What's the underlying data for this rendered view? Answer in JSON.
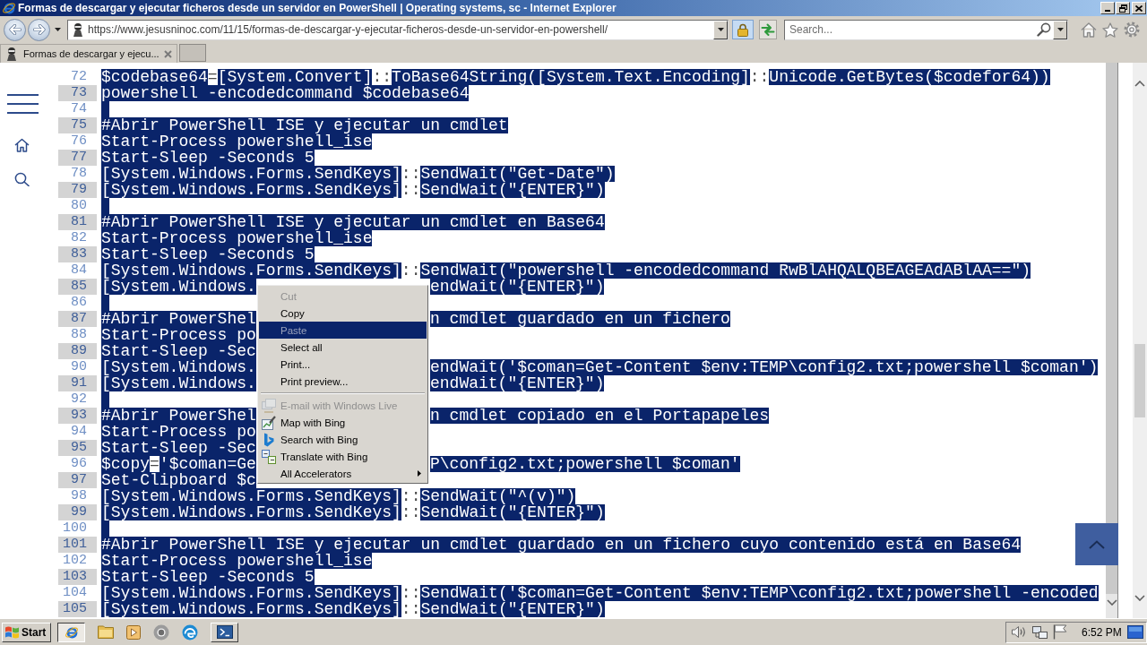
{
  "window": {
    "title": "Formas de descargar y ejecutar ficheros desde un servidor en PowerShell | Operating systems, sc - Internet Explorer"
  },
  "address_bar": {
    "url": "https://www.jesusninoc.com/11/15/formas-de-descargar-y-ejecutar-ficheros-desde-un-servidor-en-powershell/"
  },
  "search": {
    "placeholder": "Search..."
  },
  "tabs": [
    {
      "label": "Formas de descargar y ejecu...",
      "selected": true
    }
  ],
  "code_lines": [
    {
      "number": "72",
      "kind": "code",
      "segments": [
        {
          "text": "$codebase64",
          "selected": true
        },
        {
          "text": "=",
          "selected": false
        },
        {
          "text": "[System.Convert]",
          "selected": true
        },
        {
          "text": "::",
          "selected": false
        },
        {
          "text": "ToBase64String([System.Text.Encoding]",
          "selected": true
        },
        {
          "text": "::",
          "selected": false
        },
        {
          "text": "Unicode.GetBytes($codefor64))",
          "selected": true
        }
      ]
    },
    {
      "number": "73",
      "kind": "code",
      "segments": [
        {
          "text": "powershell -encodedcommand $codebase64",
          "selected": true
        }
      ]
    },
    {
      "number": "74",
      "kind": "blank",
      "selected": true
    },
    {
      "number": "75",
      "kind": "code",
      "segments": [
        {
          "text": "#Abrir PowerShell ISE y ejecutar un cmdlet",
          "selected": true
        }
      ]
    },
    {
      "number": "76",
      "kind": "code",
      "segments": [
        {
          "text": "Start-Process powershell_ise",
          "selected": true
        }
      ]
    },
    {
      "number": "77",
      "kind": "code",
      "segments": [
        {
          "text": "Start-Sleep -Seconds 5",
          "selected": true
        }
      ]
    },
    {
      "number": "78",
      "kind": "code",
      "segments": [
        {
          "text": "[System.Windows.Forms.SendKeys]",
          "selected": true
        },
        {
          "text": "::",
          "selected": false
        },
        {
          "text": "SendWait(\"Get-Date\")",
          "selected": true
        }
      ]
    },
    {
      "number": "79",
      "kind": "code",
      "segments": [
        {
          "text": "[System.Windows.Forms.SendKeys]",
          "selected": true
        },
        {
          "text": "::",
          "selected": false
        },
        {
          "text": "SendWait(\"{ENTER}\")",
          "selected": true
        }
      ]
    },
    {
      "number": "80",
      "kind": "blank",
      "selected": true
    },
    {
      "number": "81",
      "kind": "code",
      "segments": [
        {
          "text": "#Abrir PowerShell ISE y ejecutar un cmdlet en Base64",
          "selected": true
        }
      ]
    },
    {
      "number": "82",
      "kind": "code",
      "segments": [
        {
          "text": "Start-Process powershell_ise",
          "selected": true
        }
      ]
    },
    {
      "number": "83",
      "kind": "code",
      "segments": [
        {
          "text": "Start-Sleep -Seconds 5",
          "selected": true
        }
      ]
    },
    {
      "number": "84",
      "kind": "code",
      "segments": [
        {
          "text": "[System.Windows.Forms.SendKeys]",
          "selected": true
        },
        {
          "text": "::",
          "selected": false
        },
        {
          "text": "SendWait(\"powershell -encodedcommand RwBlAHQALQBEAGEAdABlAA==\")",
          "selected": true
        }
      ]
    },
    {
      "number": "85",
      "kind": "covered",
      "segments": [
        {
          "text": "[System.Windows.",
          "selected": true
        }
      ],
      "after_menu": [
        {
          "text": "endWait(\"{ENTER}\")",
          "selected": true
        }
      ]
    },
    {
      "number": "86",
      "kind": "blank",
      "selected": true
    },
    {
      "number": "87",
      "kind": "covered",
      "segments": [
        {
          "text": "#Abrir PowerShel",
          "selected": true
        }
      ],
      "after_menu": [
        {
          "text": "n cmdlet guardado en un fichero",
          "selected": true
        }
      ]
    },
    {
      "number": "88",
      "kind": "covered",
      "segments": [
        {
          "text": "Start-Process po",
          "selected": true
        }
      ]
    },
    {
      "number": "89",
      "kind": "covered",
      "segments": [
        {
          "text": "Start-Sleep -Sec",
          "selected": true
        }
      ]
    },
    {
      "number": "90",
      "kind": "covered",
      "segments": [
        {
          "text": "[System.Windows.",
          "selected": true
        }
      ],
      "after_menu": [
        {
          "text": "endWait('$coman=Get-Content $env:TEMP\\config2.txt;powershell $coman')",
          "selected": true
        }
      ]
    },
    {
      "number": "91",
      "kind": "covered",
      "segments": [
        {
          "text": "[System.Windows.",
          "selected": true
        }
      ],
      "after_menu": [
        {
          "text": "endWait(\"{ENTER}\")",
          "selected": true
        }
      ]
    },
    {
      "number": "92",
      "kind": "blank",
      "selected": true
    },
    {
      "number": "93",
      "kind": "covered",
      "segments": [
        {
          "text": "#Abrir PowerShel",
          "selected": true
        }
      ],
      "after_menu": [
        {
          "text": "n cmdlet copiado en el Portapapeles",
          "selected": true
        }
      ]
    },
    {
      "number": "94",
      "kind": "covered",
      "segments": [
        {
          "text": "Start-Process po",
          "selected": true
        }
      ]
    },
    {
      "number": "95",
      "kind": "covered",
      "segments": [
        {
          "text": "Start-Sleep -Sec",
          "selected": true
        }
      ]
    },
    {
      "number": "96",
      "kind": "covered",
      "segments": [
        {
          "text": "$copy",
          "selected": true
        },
        {
          "text": "=",
          "selected": false
        },
        {
          "text": "'$coman=Ge",
          "selected": true
        }
      ],
      "after_menu": [
        {
          "text": "P\\config2.txt;powershell $coman'",
          "selected": true
        }
      ]
    },
    {
      "number": "97",
      "kind": "covered",
      "segments": [
        {
          "text": "Set-Clipboard $c",
          "selected": true
        }
      ]
    },
    {
      "number": "98",
      "kind": "code",
      "segments": [
        {
          "text": "[System.Windows.Forms.SendKeys]",
          "selected": true
        },
        {
          "text": "::",
          "selected": false
        },
        {
          "text": "SendWait(\"^(v)\")",
          "selected": true
        }
      ]
    },
    {
      "number": "99",
      "kind": "code",
      "segments": [
        {
          "text": "[System.Windows.Forms.SendKeys]",
          "selected": true
        },
        {
          "text": "::",
          "selected": false
        },
        {
          "text": "SendWait(\"{ENTER}\")",
          "selected": true
        }
      ]
    },
    {
      "number": "100",
      "kind": "blank",
      "selected": true
    },
    {
      "number": "101",
      "kind": "code",
      "segments": [
        {
          "text": "#Abrir PowerShell ISE y ejecutar un cmdlet guardado en un fichero cuyo contenido está en Base64",
          "selected": true
        }
      ]
    },
    {
      "number": "102",
      "kind": "code",
      "segments": [
        {
          "text": "Start-Process powershell_ise",
          "selected": true
        }
      ]
    },
    {
      "number": "103",
      "kind": "code",
      "segments": [
        {
          "text": "Start-Sleep -Seconds 5",
          "selected": true
        }
      ]
    },
    {
      "number": "104",
      "kind": "code",
      "segments": [
        {
          "text": "[System.Windows.Forms.SendKeys]",
          "selected": true
        },
        {
          "text": "::",
          "selected": false
        },
        {
          "text": "SendWait('$coman=Get-Content $env:TEMP\\config2.txt;powershell -encoded",
          "selected": true
        }
      ]
    },
    {
      "number": "105",
      "kind": "code",
      "segments": [
        {
          "text": "[System.Windows.Forms.SendKeys]",
          "selected": true
        },
        {
          "text": "::",
          "selected": false
        },
        {
          "text": "SendWait(\"{ENTER}\")",
          "selected": true
        }
      ]
    }
  ],
  "context_menu": {
    "groups": [
      {
        "items": [
          {
            "label": "Cut",
            "kind": "plain",
            "disabled": true,
            "selected": false
          },
          {
            "label": "Copy",
            "kind": "plain",
            "disabled": false,
            "selected": false
          },
          {
            "label": "Paste",
            "kind": "plain",
            "disabled": true,
            "selected": true
          },
          {
            "label": "Select all",
            "kind": "plain",
            "disabled": false,
            "selected": false
          },
          {
            "label": "Print...",
            "kind": "plain",
            "disabled": false,
            "selected": false
          },
          {
            "label": "Print preview...",
            "kind": "plain",
            "disabled": false,
            "selected": false
          }
        ]
      },
      {
        "items": [
          {
            "label": "E-mail with Windows Live",
            "kind": "accelerator",
            "disabled": true,
            "selected": false
          },
          {
            "label": "Map with Bing",
            "kind": "accelerator",
            "disabled": false,
            "selected": false
          },
          {
            "label": "Search with Bing",
            "kind": "accelerator",
            "disabled": false,
            "selected": false
          },
          {
            "label": "Translate with Bing",
            "kind": "accelerator",
            "disabled": false,
            "selected": false
          },
          {
            "label": "All Accelerators",
            "kind": "submenu",
            "disabled": false,
            "selected": false
          }
        ]
      }
    ]
  },
  "taskbar": {
    "start": "Start",
    "apps": [
      {
        "kind": "ie",
        "open": true,
        "selected": true
      },
      {
        "kind": "folder",
        "open": false,
        "selected": false
      },
      {
        "kind": "media",
        "open": false,
        "selected": false
      },
      {
        "kind": "chrome",
        "open": false,
        "selected": false
      },
      {
        "kind": "edge",
        "open": false,
        "selected": false
      },
      {
        "kind": "powershell",
        "open": true,
        "selected": false
      }
    ],
    "clock": "6:52 PM"
  }
}
